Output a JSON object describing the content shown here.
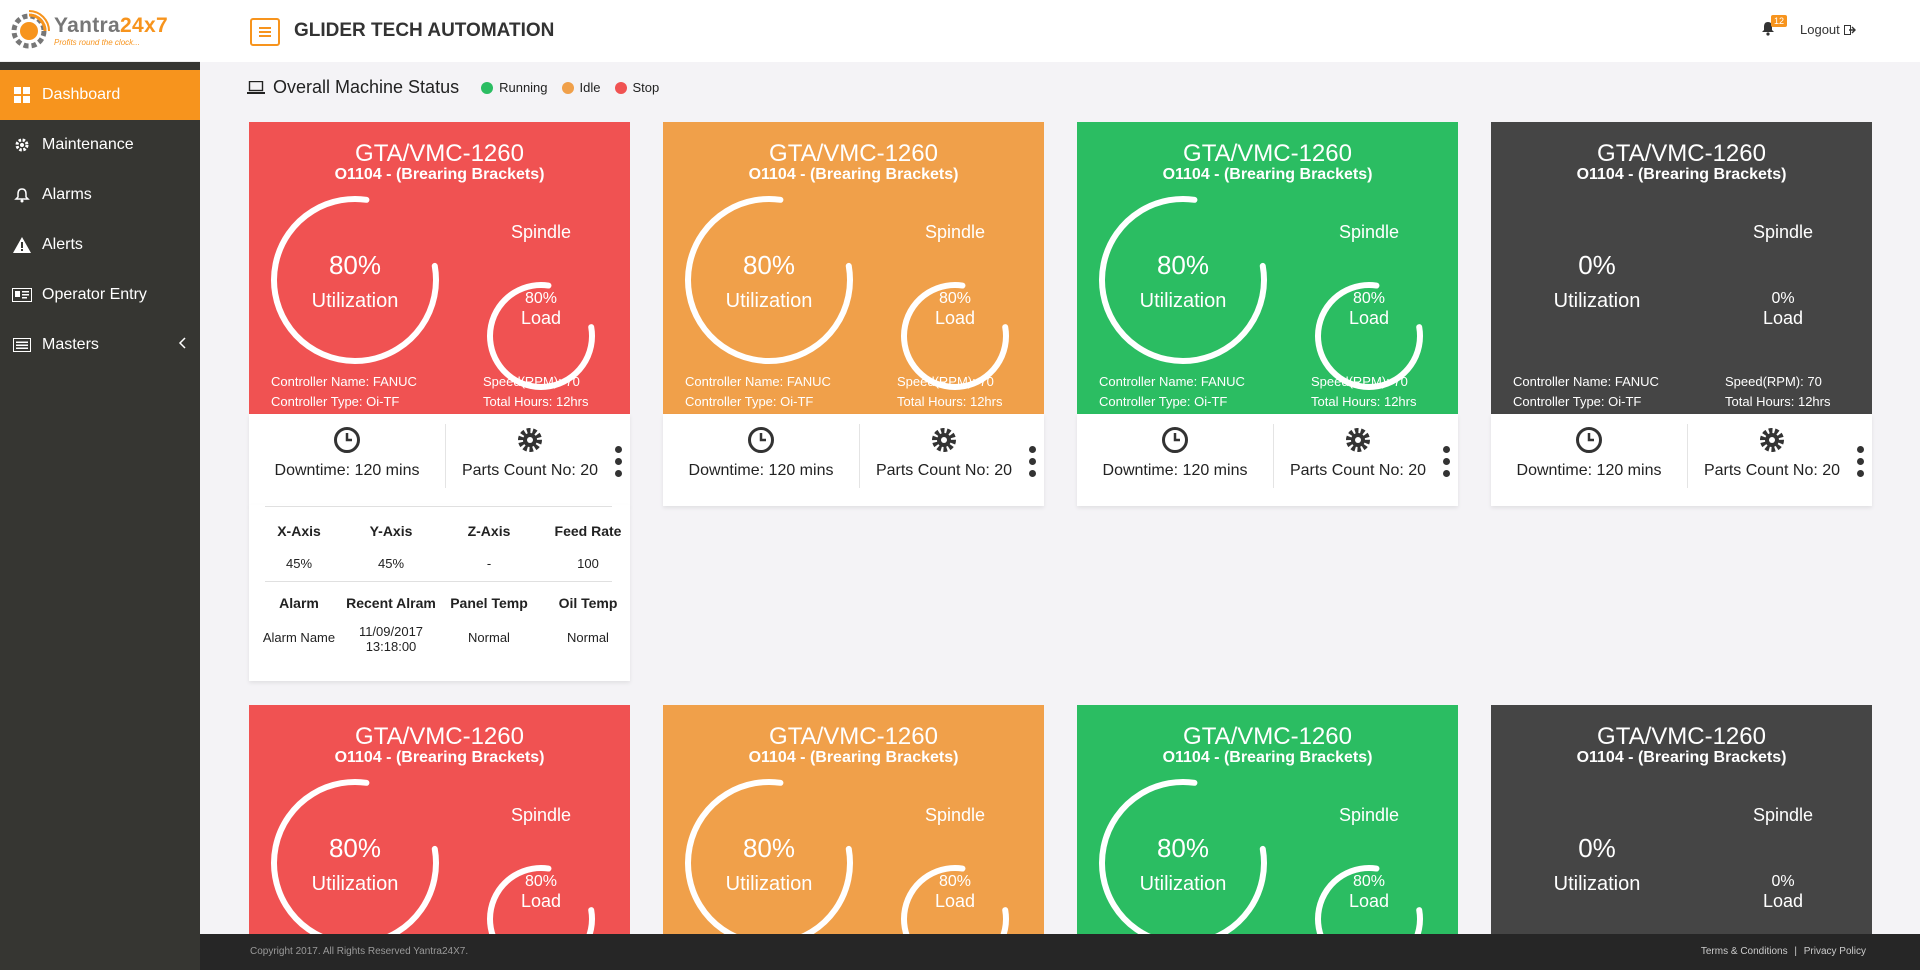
{
  "brand": {
    "name_a": "Yantra",
    "name_b": "24x7",
    "tagline": "Profits round the clock..."
  },
  "sidebar": {
    "items": [
      {
        "label": "Dashboard",
        "icon": "dashboard-icon",
        "active": true
      },
      {
        "label": "Maintenance",
        "icon": "gear-icon"
      },
      {
        "label": "Alarms",
        "icon": "bell-icon"
      },
      {
        "label": "Alerts",
        "icon": "warning-icon"
      },
      {
        "label": "Operator Entry",
        "icon": "id-card-icon"
      },
      {
        "label": "Masters",
        "icon": "list-icon"
      }
    ]
  },
  "header": {
    "company": "GLIDER TECH AUTOMATION",
    "notification_count": "12",
    "logout_label": "Logout"
  },
  "status": {
    "title": "Overall Machine Status",
    "legend": [
      {
        "label": "Running",
        "color": "#2bbd62"
      },
      {
        "label": "Idle",
        "color": "#f0a04a"
      },
      {
        "label": "Stop",
        "color": "#f05252"
      }
    ]
  },
  "cards": [
    {
      "status": "stop",
      "color": "#f05252",
      "name": "GTA/VMC-1260",
      "program": "O1104 - (Brearing Brackets)",
      "utilization": "80%",
      "utilization_value": 0.8,
      "utilization_label": "Utilization",
      "spindle_label": "Spindle",
      "load": "80%",
      "load_value": 0.8,
      "load_label": "Load",
      "controller_name": "Controller Name: FANUC",
      "controller_type": "Controller Type: Oi-TF",
      "speed": "Speed(RPM): 70",
      "total_hours": "Total Hours: 12hrs",
      "downtime": "Downtime: 120 mins",
      "parts": "Parts Count No: 20"
    },
    {
      "status": "idle",
      "color": "#f0a04a",
      "name": "GTA/VMC-1260",
      "program": "O1104 - (Brearing Brackets)",
      "utilization": "80%",
      "utilization_value": 0.8,
      "utilization_label": "Utilization",
      "spindle_label": "Spindle",
      "load": "80%",
      "load_value": 0.8,
      "load_label": "Load",
      "controller_name": "Controller Name: FANUC",
      "controller_type": "Controller Type: Oi-TF",
      "speed": "Speed(RPM): 70",
      "total_hours": "Total Hours: 12hrs",
      "downtime": "Downtime: 120 mins",
      "parts": "Parts Count No: 20"
    },
    {
      "status": "running",
      "color": "#2bbd62",
      "name": "GTA/VMC-1260",
      "program": "O1104 - (Brearing Brackets)",
      "utilization": "80%",
      "utilization_value": 0.8,
      "utilization_label": "Utilization",
      "spindle_label": "Spindle",
      "load": "80%",
      "load_value": 0.8,
      "load_label": "Load",
      "controller_name": "Controller Name: FANUC",
      "controller_type": "Controller Type: Oi-TF",
      "speed": "Speed(RPM): 70",
      "total_hours": "Total Hours: 12hrs",
      "downtime": "Downtime: 120 mins",
      "parts": "Parts Count No: 20"
    },
    {
      "status": "offline",
      "color": "#454545",
      "name": "GTA/VMC-1260",
      "program": "O1104 - (Brearing Brackets)",
      "utilization": "0%",
      "utilization_value": 0,
      "utilization_label": "Utilization",
      "spindle_label": "Spindle",
      "load": "0%",
      "load_value": 0,
      "load_label": "Load",
      "controller_name": "Controller Name: FANUC",
      "controller_type": "Controller Type: Oi-TF",
      "speed": "Speed(RPM): 70",
      "total_hours": "Total Hours: 12hrs",
      "downtime": "Downtime: 120 mins",
      "parts": "Parts Count No: 20"
    },
    {
      "status": "stop",
      "color": "#f05252",
      "name": "GTA/VMC-1260",
      "program": "O1104 - (Brearing Brackets)",
      "utilization": "80%",
      "utilization_value": 0.8,
      "utilization_label": "Utilization",
      "spindle_label": "Spindle",
      "load": "80%",
      "load_value": 0.8,
      "load_label": "Load"
    },
    {
      "status": "idle",
      "color": "#f0a04a",
      "name": "GTA/VMC-1260",
      "program": "O1104 - (Brearing Brackets)",
      "utilization": "80%",
      "utilization_value": 0.8,
      "utilization_label": "Utilization",
      "spindle_label": "Spindle",
      "load": "80%",
      "load_value": 0.8,
      "load_label": "Load"
    },
    {
      "status": "running",
      "color": "#2bbd62",
      "name": "GTA/VMC-1260",
      "program": "O1104 - (Brearing Brackets)",
      "utilization": "80%",
      "utilization_value": 0.8,
      "utilization_label": "Utilization",
      "spindle_label": "Spindle",
      "load": "80%",
      "load_value": 0.8,
      "load_label": "Load"
    },
    {
      "status": "offline",
      "color": "#454545",
      "name": "GTA/VMC-1260",
      "program": "O1104 - (Brearing Brackets)",
      "utilization": "0%",
      "utilization_value": 0,
      "utilization_label": "Utilization",
      "spindle_label": "Spindle",
      "load": "0%",
      "load_value": 0,
      "load_label": "Load"
    }
  ],
  "details": {
    "axis_headers": [
      "X-Axis",
      "Y-Axis",
      "Z-Axis",
      "Feed Rate"
    ],
    "axis_values": [
      "45%",
      "45%",
      "-",
      "100"
    ],
    "alarm_headers": [
      "Alarm",
      "Recent Alram",
      "Panel Temp",
      "Oil Temp"
    ],
    "alarm_name": "Alarm Name",
    "recent_date": "11/09/2017",
    "recent_time": "13:18:00",
    "panel_temp": "Normal",
    "oil_temp": "Normal"
  },
  "footer": {
    "copyright": "Copyright 2017. All Rights Reserved Yantra24X7.",
    "terms": "Terms & Conditions",
    "sep": "|",
    "privacy": "Privacy Policy"
  }
}
